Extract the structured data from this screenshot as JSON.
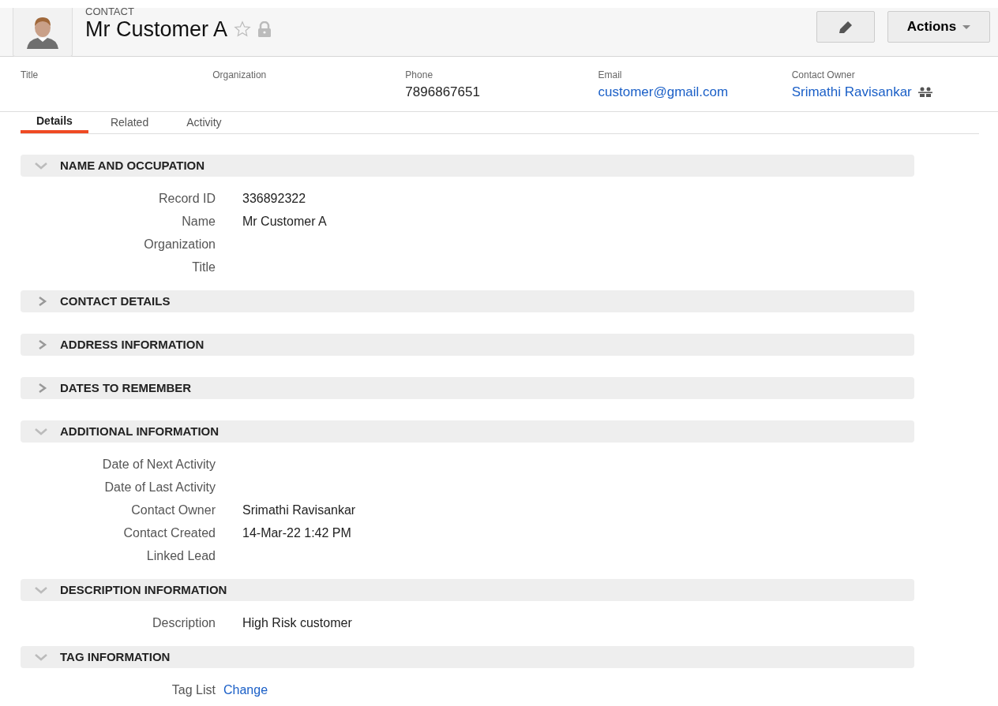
{
  "header": {
    "record_type": "CONTACT",
    "name": "Mr Customer A",
    "favorite": false,
    "locked": true,
    "actions_label": "Actions"
  },
  "summary": [
    {
      "label": "Title"
    },
    {
      "label": "Organization"
    },
    {
      "label": "Phone",
      "value": "7896867651",
      "link": false
    },
    {
      "label": "Email",
      "value": "customer@gmail.com",
      "link": true
    },
    {
      "label": "Contact Owner",
      "value": "Srimathi Ravisankar",
      "link": true,
      "icon": true
    }
  ],
  "tabs": [
    {
      "label": "Details",
      "selected": true
    },
    {
      "label": "Related",
      "selected": false
    },
    {
      "label": "Activity",
      "selected": false
    }
  ],
  "sections": [
    {
      "title": "NAME AND OCCUPATION",
      "expanded": true,
      "fields": [
        {
          "label": "Record ID",
          "value": "336892322"
        },
        {
          "label": "Name",
          "value": "Mr Customer A"
        },
        {
          "label": "Organization"
        },
        {
          "label": "Title"
        }
      ]
    },
    {
      "title": "CONTACT DETAILS",
      "expanded": false
    },
    {
      "title": "ADDRESS INFORMATION",
      "expanded": false
    },
    {
      "title": "DATES TO REMEMBER",
      "expanded": false
    },
    {
      "title": "ADDITIONAL INFORMATION",
      "expanded": true,
      "fields": [
        {
          "label": "Date of Next Activity"
        },
        {
          "label": "Date of Last Activity"
        },
        {
          "label": "Contact Owner",
          "value": "Srimathi Ravisankar"
        },
        {
          "label": "Contact Created",
          "value": "14-Mar-22 1:42 PM"
        },
        {
          "label": "Linked Lead"
        }
      ]
    },
    {
      "title": "DESCRIPTION INFORMATION",
      "expanded": true,
      "fields": [
        {
          "label": "Description",
          "value": "High Risk customer"
        }
      ]
    },
    {
      "title": "TAG INFORMATION",
      "expanded": true,
      "fields": [
        {
          "label": "Tag List",
          "value": "Change",
          "link": true
        }
      ]
    }
  ]
}
